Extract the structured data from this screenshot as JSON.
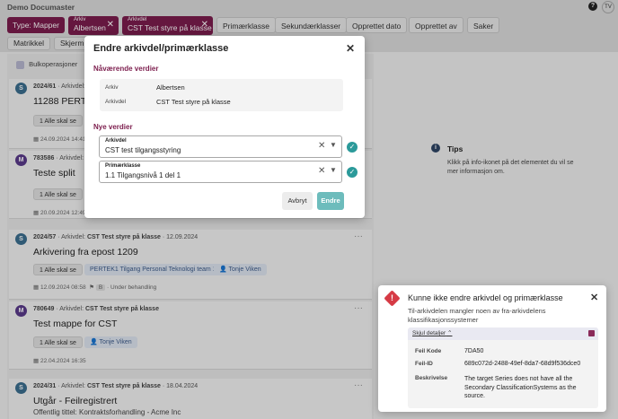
{
  "app": {
    "title": "Demo Documaster",
    "help_icon": "?",
    "user_initials": "TV"
  },
  "filters": {
    "type_chip": "Type: Mapper",
    "arkiv_chip": {
      "label": "Arkiv",
      "value": "Albertsen"
    },
    "arkivdel_chip": {
      "label": "Arkivdel",
      "value": "CST Test styre på klasse"
    },
    "buttons": [
      "Primærklasse",
      "Sekundærklasser",
      "Opprettet dato",
      "Opprettet av",
      "Saker"
    ],
    "row2": [
      "Matrikkel",
      "Skjerm"
    ]
  },
  "list": {
    "bulk_label": "Bulkoperasjoner",
    "cards": [
      {
        "avatar": "S",
        "meta_id": "2024/61",
        "meta_prefix": "Arkivdel:",
        "meta_arkivdel": "",
        "meta_date": "",
        "title": "11288 PERTEK",
        "subtitle": "",
        "pills": [
          "1 Alle skal se"
        ],
        "date": "24.09.2024 14:41"
      },
      {
        "avatar": "M",
        "meta_id": "783586",
        "meta_prefix": "Arkivdel: C",
        "meta_arkivdel": "",
        "meta_date": "",
        "title": "Teste split",
        "subtitle": "",
        "pills": [
          "1 Alle skal se"
        ],
        "date": "20.09.2024 12:49"
      },
      {
        "avatar": "S",
        "meta_id": "2024/57",
        "meta_prefix": "Arkivdel:",
        "meta_arkivdel": "CST Test styre på klasse",
        "meta_date": "12.09.2024",
        "title": "Arkivering fra epost 1209",
        "subtitle": "",
        "pills": [
          "1 Alle skal se",
          "PERTEK1 Tilgang Personal Teknologi team 1"
        ],
        "person": "Tonje Viken",
        "date": "12.09.2024 08:58",
        "flag": "B",
        "status": "Under behandling"
      },
      {
        "avatar": "M",
        "meta_id": "780649",
        "meta_prefix": "Arkivdel:",
        "meta_arkivdel": "CST Test styre på klasse",
        "meta_date": "",
        "title": "Test mappe for CST",
        "subtitle": "",
        "pills": [
          "1 Alle skal se"
        ],
        "person": "Tonje Viken",
        "date": "22.04.2024 16:35"
      },
      {
        "avatar": "S",
        "meta_id": "2024/31",
        "meta_prefix": "Arkivdel:",
        "meta_arkivdel": "CST Test styre på klasse",
        "meta_date": "18.04.2024",
        "title": "Utgår - Feilregistrert",
        "subtitle": "Offentlig tittel: Kontraktsforhandling - Acme Inc",
        "pills": [],
        "date": ""
      }
    ]
  },
  "tips": {
    "icon": "i",
    "title": "Tips",
    "text": "Klikk på info-ikonet på det elementet du vil se mer informasjon om."
  },
  "modal": {
    "title": "Endre arkivdel/primærklasse",
    "current_title": "Nåværende verdier",
    "current": [
      {
        "label": "Arkiv",
        "value": "Albertsen"
      },
      {
        "label": "Arkivdel",
        "value": "CST Test styre på klasse"
      }
    ],
    "new_title": "Nye verdier",
    "arkivdel_select": {
      "label": "Arkivdel",
      "value": "CST test tilgangsstyring"
    },
    "primaerklasse_select": {
      "label": "Primærklasse",
      "value": "1.1 Tilgangsnivå 1 del 1"
    },
    "cancel_label": "Avbryt",
    "submit_label": "Endre"
  },
  "error_toast": {
    "title": "Kunne ikke endre arkivdel og primærklasse",
    "message": "Til-arkivdelen mangler noen av fra-arkivdelens klassifikasjonssystemer",
    "hide_details": "Skjul detaljer",
    "details": [
      {
        "label": "Feil Kode",
        "value": "7DA50"
      },
      {
        "label": "Feil-ID",
        "value": "689c072d-2488-49ef-8da7-68d9f536dce0"
      },
      {
        "label": "Beskrivelse",
        "value": "The target Series does not have all the Secondary ClassificationSystems as the source."
      }
    ]
  },
  "colors": {
    "brand": "#7c1d4d",
    "accent": "#2b9a9a",
    "error": "#d63a45"
  }
}
